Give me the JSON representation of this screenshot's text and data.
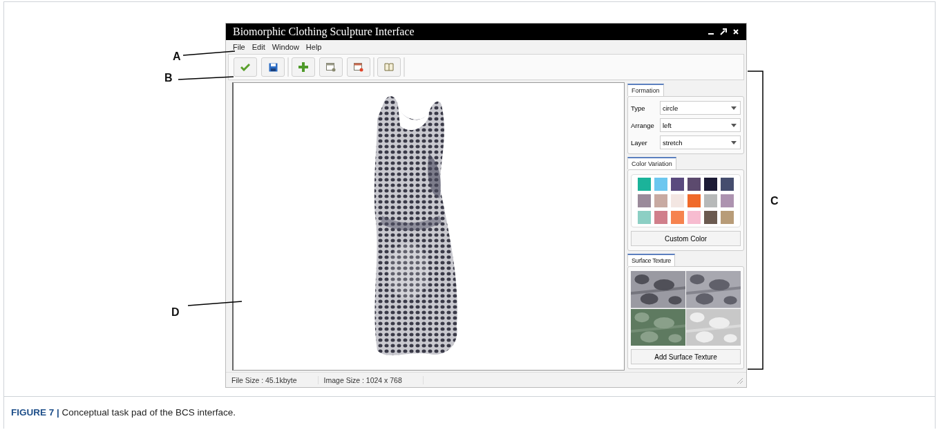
{
  "annotations": [
    {
      "label": "A"
    },
    {
      "label": "B"
    },
    {
      "label": "C"
    },
    {
      "label": "D"
    }
  ],
  "window": {
    "title": "Biomorphic Clothing Sculpture Interface"
  },
  "menu": [
    "File",
    "Edit",
    "Window",
    "Help"
  ],
  "formation": {
    "tab": {
      "label": "Formation",
      "selected": true
    },
    "fields": [
      {
        "label": "Type",
        "value": "circle"
      },
      {
        "label": "Arrange",
        "value": "left"
      },
      {
        "label": "Layer",
        "value": "stretch"
      }
    ]
  },
  "color_variation": {
    "tab": {
      "label": "Color Variation",
      "selected": true
    },
    "swatches": [
      {
        "color": "#1bb39a"
      },
      {
        "color": "#6cc7ef"
      },
      {
        "color": "#5a4a7e"
      },
      {
        "color": "#5c4a6e"
      },
      {
        "color": "#1c1b35"
      },
      {
        "color": "#454d6e"
      },
      {
        "color": "#9a8a9a"
      },
      {
        "color": "#c8aaa2"
      },
      {
        "color": "#f3e6e2"
      },
      {
        "color": "#f06a2a"
      },
      {
        "color": "#b7b9b9"
      },
      {
        "color": "#ad93b0"
      },
      {
        "color": "#8ccfc4"
      },
      {
        "color": "#d07f8b"
      },
      {
        "color": "#f6834f"
      },
      {
        "color": "#f7bcd0"
      },
      {
        "color": "#6b5a50"
      },
      {
        "color": "#b89c78"
      }
    ],
    "button": "Custom Color"
  },
  "surface_texture": {
    "tab": {
      "label": "Surface Texture",
      "selected": true
    },
    "button": "Add Surface Texture"
  },
  "status_bar": [
    "File Size : 45.1kbyte",
    "Image Size : 1024 x 768"
  ],
  "caption": "**FIGURE 7 |** Conceptual task pad of the BCS interface."
}
